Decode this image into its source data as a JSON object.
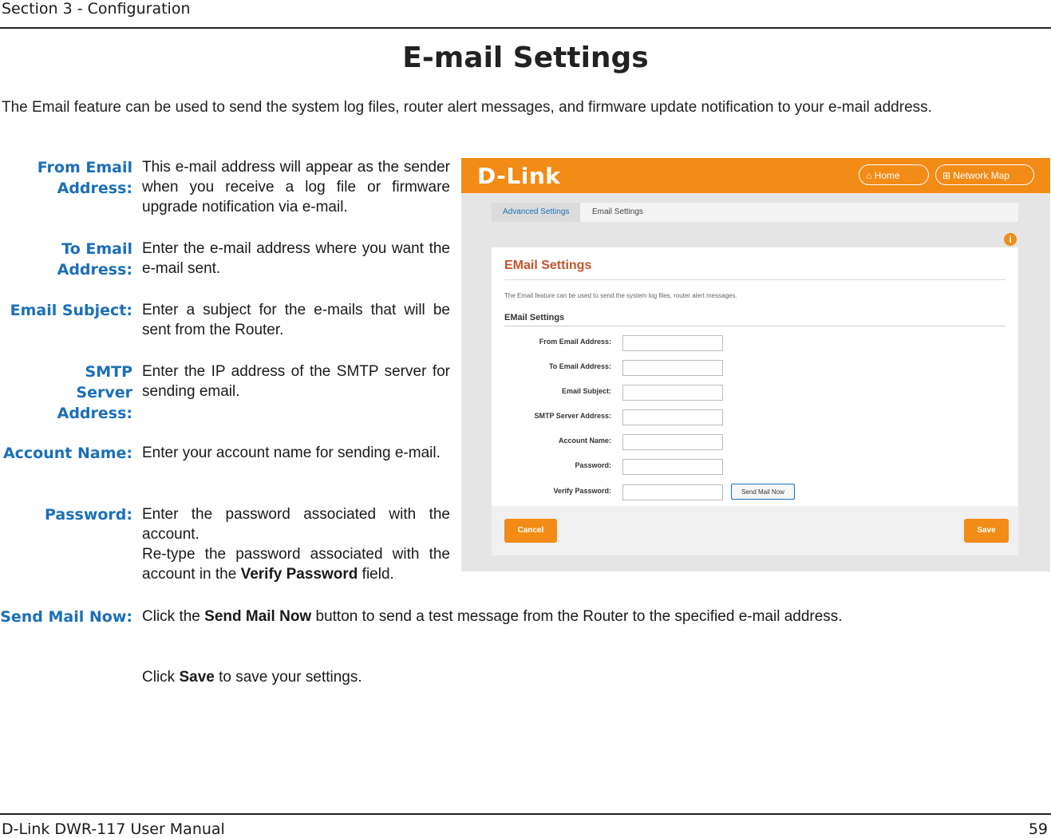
{
  "header": {
    "section": "Section 3 - Configuration"
  },
  "title": "E-mail Settings",
  "intro": "The Email feature can be used to send the system log files, router alert messages, and firmware update notification to your e-mail address.",
  "items": [
    {
      "label": "From Email Address:",
      "desc": "This e-mail address will appear as the sender when you receive a log file or firmware upgrade notification via e-mail."
    },
    {
      "label": "To Email Address:",
      "desc": "Enter the e-mail address where you want the e-mail sent."
    },
    {
      "label": "Email Subject:",
      "desc": "Enter a subject for the e-mails that will be sent from the Router."
    },
    {
      "label": "SMTP Server Address:",
      "desc": "Enter the IP address of the SMTP server for sending email."
    },
    {
      "label": "Account Name:",
      "desc": "Enter your account name for sending e-mail."
    },
    {
      "label": "Password:",
      "desc": "Enter the password associated with the account."
    }
  ],
  "verify": {
    "pre": "Re-type the password associated with the account in the ",
    "bold": "Verify Password",
    "post": " field."
  },
  "send_now": {
    "label": "Send Mail Now:",
    "pre": "Click the ",
    "bold": "Send Mail Now",
    "post": " button to send a test message from the Router to the specified e-mail address."
  },
  "save_note": {
    "pre": "Click ",
    "bold": "Save",
    "post": " to save your settings."
  },
  "footer": {
    "manual": "D-Link DWR-117 User Manual",
    "page": "59"
  },
  "screenshot": {
    "logo": "D-Link",
    "nav_home": "Home",
    "nav_map": "Network Map",
    "crumb_advanced": "Advanced Settings",
    "crumb_current": "Email Settings",
    "panel_title": "EMail Settings",
    "panel_desc": "The Email feature can be used to send the system log files, router alert messages.",
    "section_title": "EMail Settings",
    "fields": [
      "From Email Address:",
      "To Email Address:",
      "Email Subject:",
      "SMTP Server Address:",
      "Account Name:",
      "Password:",
      "Verify Password:"
    ],
    "send_button": "Send Mail Now",
    "cancel_button": "Cancel",
    "save_button": "Save",
    "accent_color": "#f28c16"
  }
}
